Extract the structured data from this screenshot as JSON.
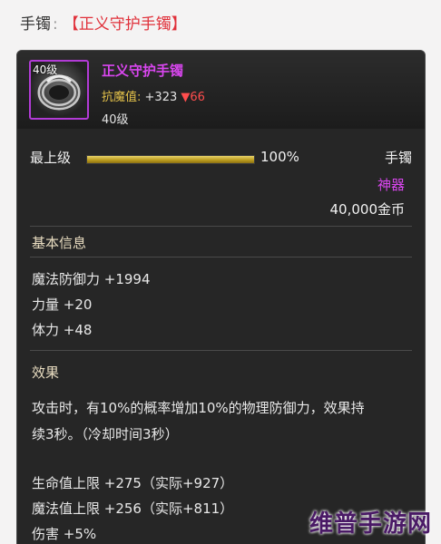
{
  "header": {
    "label": "手镯",
    "separator": ":",
    "item_name": "【正义守护手镯】"
  },
  "item": {
    "icon_level": "40级",
    "icon": "bracelet-icon",
    "name": "正义守护手镯",
    "resist_label": "抗魔值:",
    "resist_value": "+323",
    "resist_delta": "▼66",
    "level": "40级",
    "grade_label": "最上级",
    "grade_percent": "100%",
    "grade_fill": 1.0,
    "slot_type": "手镯",
    "rarity": "神器",
    "price": "40,000金币"
  },
  "basic_info": {
    "title": "基本信息",
    "stats": [
      "魔法防御力 +1994",
      "力量 +20",
      "体力 +48"
    ]
  },
  "effect": {
    "title": "效果",
    "lines": [
      "攻击时，有10%的概率增加10%的物理防御力，效果持",
      "续3秒。（冷却时间3秒）"
    ],
    "bonuses": [
      "生命值上限 +275（实际+927）",
      "魔法值上限 +256（实际+811）",
      "伤害 +5%"
    ]
  },
  "colors": {
    "rarity": "#d946ef",
    "name": "#d946ef",
    "header_name": "#e0303a",
    "card_bg": "#262626",
    "bar": "#c9a82a"
  },
  "watermark": "维普手游网"
}
